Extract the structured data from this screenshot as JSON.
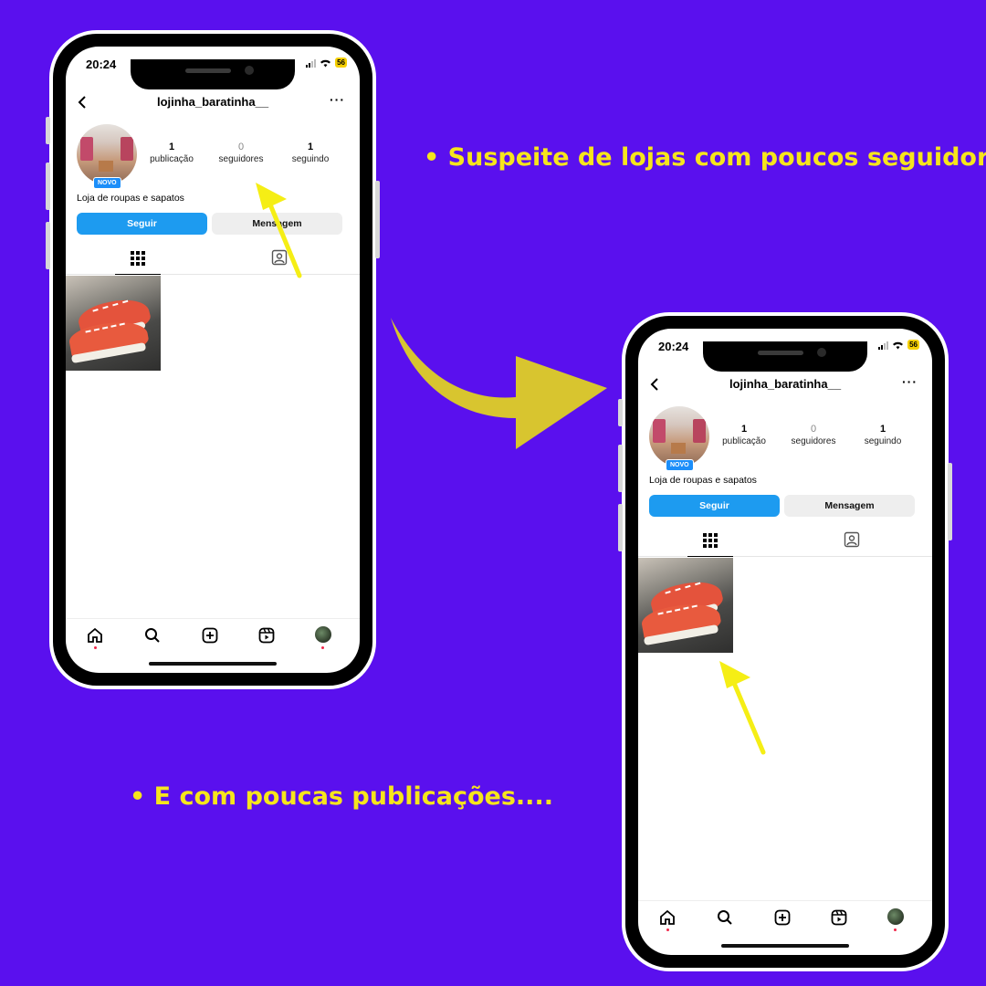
{
  "captions": {
    "top": "• Suspeite de lojas com poucos seguidores.",
    "bottom": "• E com poucas publicações...."
  },
  "colors": {
    "background": "#5a10ee",
    "caption": "#f6e51c",
    "arrow_big": "#d8c52f",
    "arrow_small": "#f5ee15",
    "follow_button": "#1d9bf0"
  },
  "phone": {
    "status": {
      "time": "20:24",
      "battery": "56"
    },
    "username": "lojinha_baratinha__",
    "more_icon": "more-dots-icon",
    "back_icon": "chevron-left-icon",
    "badge": "NOVO",
    "stats": [
      {
        "value": "1",
        "label": "publicação"
      },
      {
        "value": "0",
        "label": "seguidores"
      },
      {
        "value": "1",
        "label": "seguindo"
      }
    ],
    "bio": "Loja de roupas e sapatos",
    "buttons": {
      "follow": "Seguir",
      "message": "Mensagem"
    },
    "tabs": [
      "grid-icon",
      "tagged-icon"
    ],
    "posts_count": 1,
    "nav": [
      "home-icon",
      "search-icon",
      "add-icon",
      "reels-icon",
      "profile-avatar"
    ]
  }
}
